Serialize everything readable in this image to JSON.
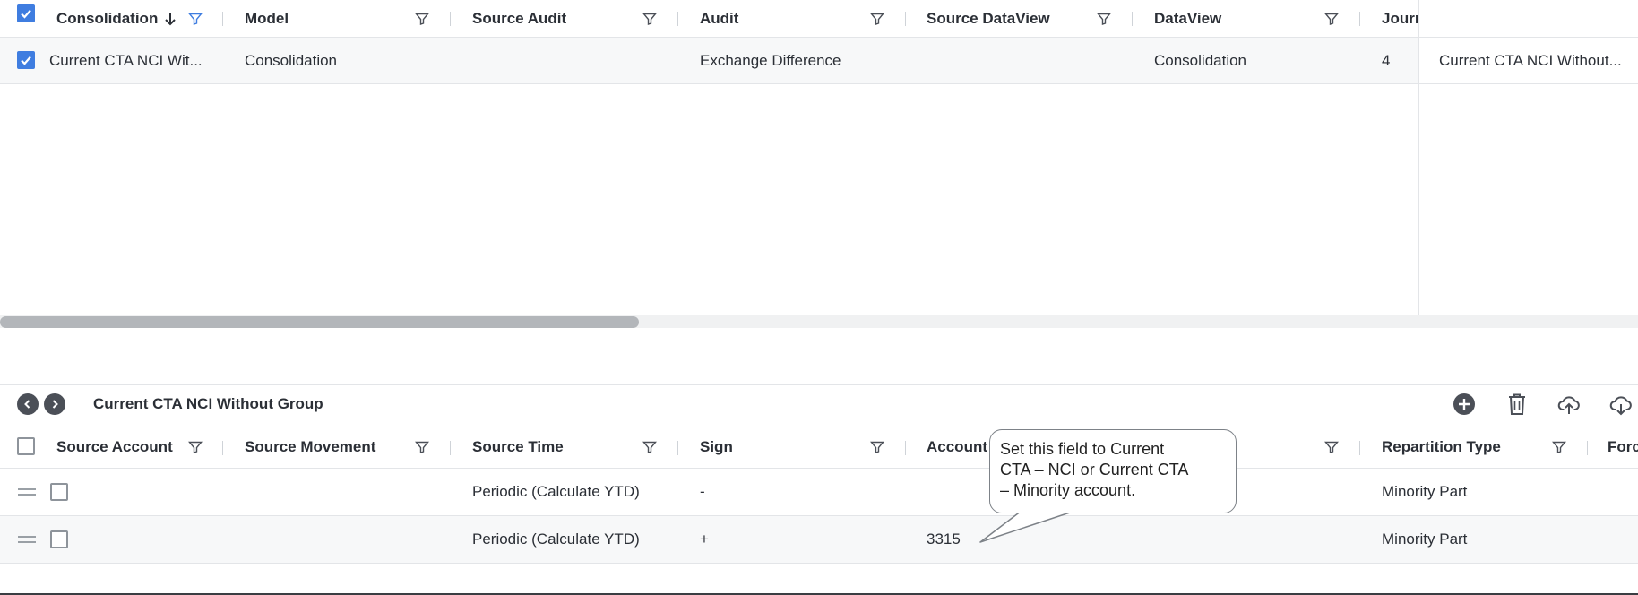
{
  "top_grid": {
    "columns": [
      {
        "label": "Consolidation"
      },
      {
        "label": "Model"
      },
      {
        "label": "Source Audit"
      },
      {
        "label": "Audit"
      },
      {
        "label": "Source DataView"
      },
      {
        "label": "DataView"
      },
      {
        "label": "Journ"
      }
    ],
    "row": {
      "consolidation": "Current CTA NCI Wit...",
      "model": "Consolidation",
      "source_audit": "",
      "audit": "Exchange Difference",
      "source_dataview": "",
      "dataview": "Consolidation",
      "journal": "4",
      "pinned": "Current CTA NCI Without..."
    },
    "scroll_fraction_visible": 0.39
  },
  "bottom_grid": {
    "group_title": "Current CTA NCI Without Group",
    "columns": [
      {
        "label": "Source Account"
      },
      {
        "label": "Source Movement"
      },
      {
        "label": "Source Time"
      },
      {
        "label": "Sign"
      },
      {
        "label": "Account"
      },
      {
        "label": ""
      },
      {
        "label": "Repartition Type"
      },
      {
        "label": "Forc"
      }
    ],
    "rows": [
      {
        "source_account": "",
        "source_movement": "",
        "source_time": "Periodic (Calculate YTD)",
        "sign": "-",
        "account": "",
        "repartition_type": "Minority Part"
      },
      {
        "source_account": "",
        "source_movement": "",
        "source_time": "Periodic (Calculate YTD)",
        "sign": "+",
        "account": "3315",
        "repartition_type": "Minority Part"
      }
    ]
  },
  "callout": {
    "line1": "Set this field to Current",
    "line2": "CTA – NCI or Current CTA",
    "line3": "– Minority account."
  },
  "icons": {
    "prev": "chevron-left-icon",
    "next": "chevron-right-icon",
    "add": "plus-circle-icon",
    "delete": "trash-icon",
    "upload": "cloud-upload-icon",
    "download": "cloud-download-icon",
    "filter": "filter-icon",
    "sort": "sort-desc-icon"
  },
  "colors": {
    "accent": "#3f7de0",
    "text": "#2b2f36",
    "icon": "#4b4f57"
  }
}
